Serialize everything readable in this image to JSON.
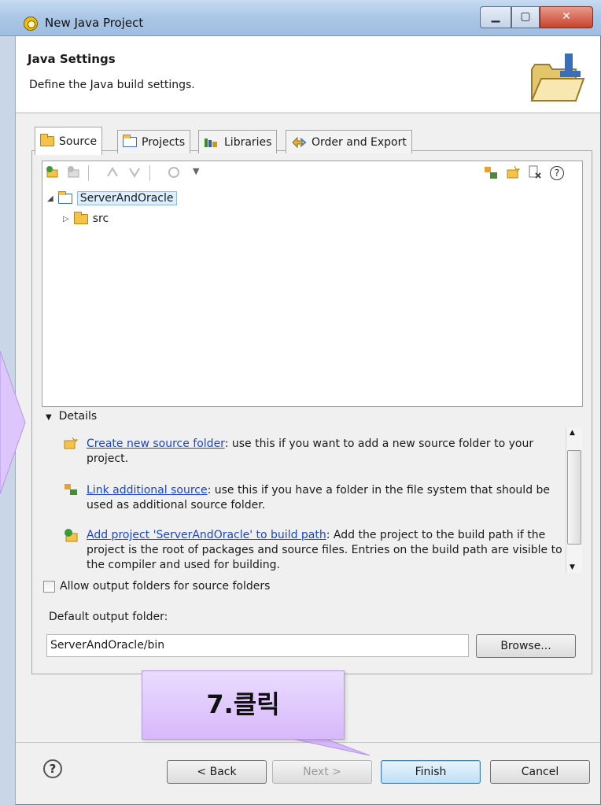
{
  "window": {
    "title": "New Java Project"
  },
  "header": {
    "title": "Java Settings",
    "description": "Define the Java build settings."
  },
  "tabs": [
    {
      "label": "Source",
      "icon": "source-folder-icon",
      "active": true
    },
    {
      "label": "Projects",
      "icon": "projects-folder-icon",
      "active": false
    },
    {
      "label": "Libraries",
      "icon": "libraries-icon",
      "active": false
    },
    {
      "label": "Order and Export",
      "icon": "order-export-icon",
      "active": false
    }
  ],
  "toolbar": {
    "help_glyph": "?"
  },
  "tree": {
    "project": "ServerAndOracle",
    "child": "src"
  },
  "details": {
    "label": "Details",
    "items": [
      {
        "link": "Create new source folder",
        "text": ": use this if you want to add a new source folder to your project."
      },
      {
        "link": "Link additional source",
        "text": ": use this if you have a folder in the file system that should be used as additional source folder."
      },
      {
        "link": "Add project 'ServerAndOracle' to build path",
        "text": ": Add the project to the build path if the project is the root of packages and source files. Entries on the build path are visible to the compiler and used for building."
      }
    ]
  },
  "options": {
    "allow_output_label": "Allow output folders for source folders",
    "allow_output_checked": false,
    "default_output_label": "Default output folder:",
    "default_output_value": "ServerAndOracle/bin",
    "browse_label": "Browse..."
  },
  "footer": {
    "help_glyph": "?",
    "back_label": "< Back",
    "next_label": "Next >",
    "finish_label": "Finish",
    "cancel_label": "Cancel"
  },
  "annotation": {
    "callout_text": "7.클릭"
  },
  "colors": {
    "link": "#1a47c4",
    "callout": "#d7b8fa",
    "default_button": "#bfe0f5"
  }
}
